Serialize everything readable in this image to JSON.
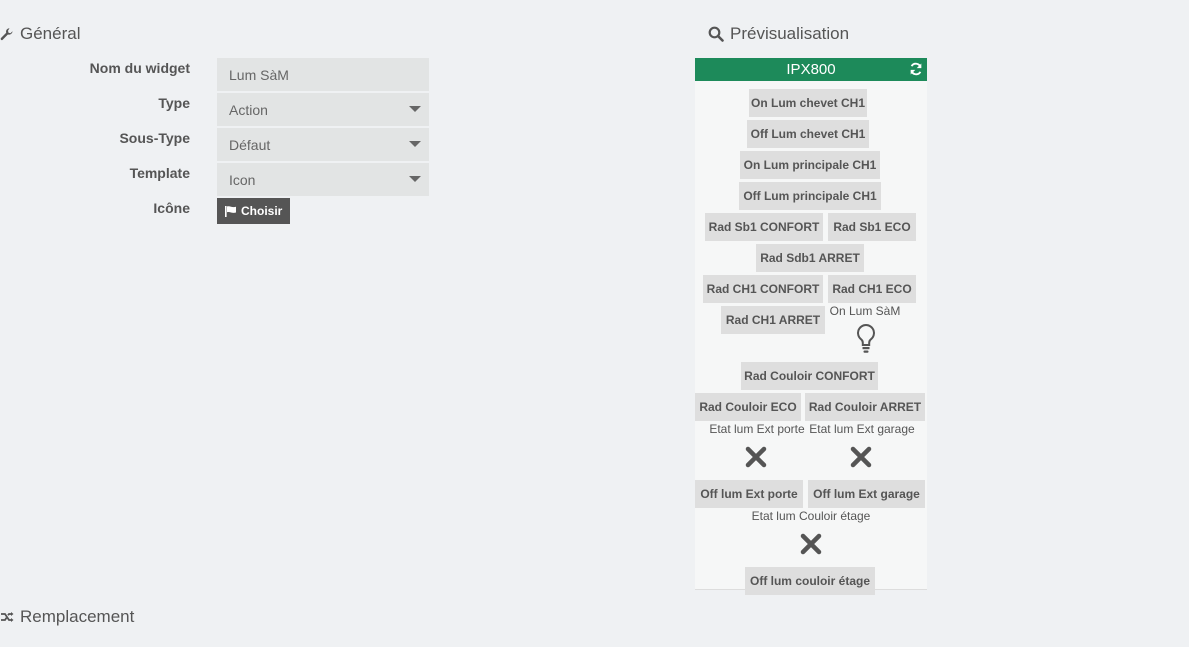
{
  "sections": {
    "general": "Général",
    "preview": "Prévisualisation",
    "replacement": "Remplacement"
  },
  "form": {
    "name_label": "Nom du widget",
    "name_value": "Lum SàM",
    "type_label": "Type",
    "type_value": "Action",
    "subtype_label": "Sous-Type",
    "subtype_value": "Défaut",
    "template_label": "Template",
    "template_value": "Icon",
    "icon_label": "Icône",
    "choose_label": "Choisir"
  },
  "widget": {
    "title": "IPX800",
    "header_color": "#1d8a5a",
    "commands": {
      "on_chevet": "On Lum chevet CH1",
      "off_chevet": "Off Lum chevet CH1",
      "on_principale": "On Lum principale CH1",
      "off_principale": "Off Lum principale CH1",
      "rad_sb1_confort": "Rad Sb1 CONFORT",
      "rad_sb1_eco": "Rad Sb1 ECO",
      "rad_sdb1_arret": "Rad Sdb1 ARRET",
      "rad_ch1_confort": "Rad CH1 CONFORT",
      "rad_ch1_eco": "Rad CH1 ECO",
      "rad_ch1_arret": "Rad CH1 ARRET",
      "rad_couloir_confort": "Rad Couloir CONFORT",
      "rad_couloir_eco": "Rad Couloir ECO",
      "rad_couloir_arret": "Rad Couloir ARRET",
      "off_ext_porte": "Off lum Ext porte",
      "off_ext_garage": "Off lum Ext garage",
      "off_couloir_etage": "Off lum couloir étage"
    },
    "infos": {
      "on_lum_sam": "On Lum SàM",
      "etat_ext_porte": "Etat lum Ext porte",
      "etat_ext_garage": "Etat lum Ext garage",
      "etat_couloir_etage": "Etat lum Couloir étage"
    },
    "icons": {
      "on_lum_sam": "lightbulb-icon",
      "etat_ext_porte": "cross-icon",
      "etat_ext_garage": "cross-icon",
      "etat_couloir_etage": "cross-icon"
    }
  }
}
